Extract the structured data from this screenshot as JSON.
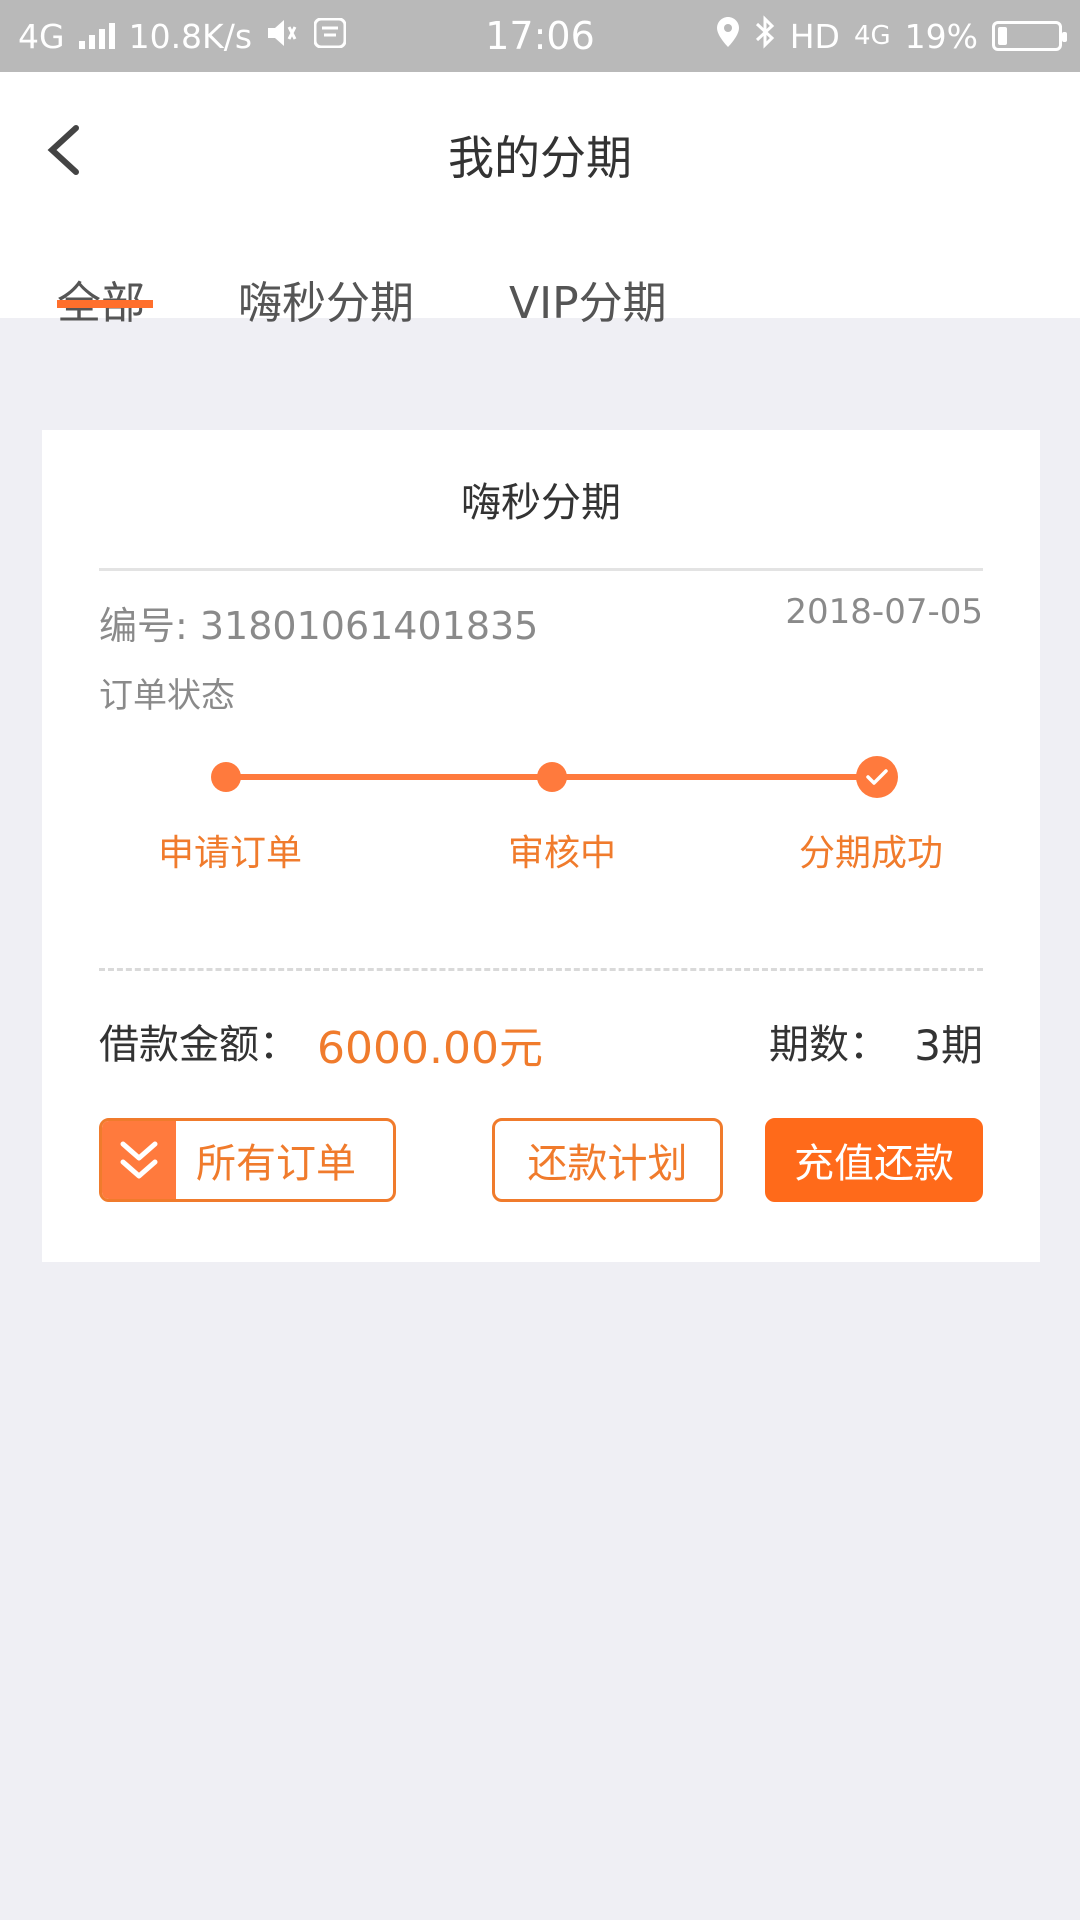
{
  "status_bar": {
    "network_left": "4G",
    "speed": "10.8K/s",
    "time": "17:06",
    "hd": "HD",
    "network_right": "4G",
    "battery": "19%"
  },
  "header": {
    "title": "我的分期",
    "back_icon": "chevron-left-icon"
  },
  "tabs": [
    {
      "label": "全部",
      "active": true
    },
    {
      "label": "嗨秒分期",
      "active": false
    },
    {
      "label": "VIP分期",
      "active": false
    }
  ],
  "accent_color": "#ff7a3d",
  "card": {
    "title": "嗨秒分期",
    "order_no": "编号: 31801061401835",
    "date": "2018-07-05",
    "status_label": "订单状态",
    "steps": [
      {
        "label": "申请订单",
        "done": true
      },
      {
        "label": "审核中",
        "done": true
      },
      {
        "label": "分期成功",
        "done": true
      }
    ],
    "amount_label": "借款金额：",
    "amount_value": "6000.00元",
    "periods_label": "期数：",
    "periods_value": "3期",
    "buttons": {
      "all_orders": "所有订单",
      "repay_plan": "还款计划",
      "recharge_repay": "充值还款"
    }
  }
}
